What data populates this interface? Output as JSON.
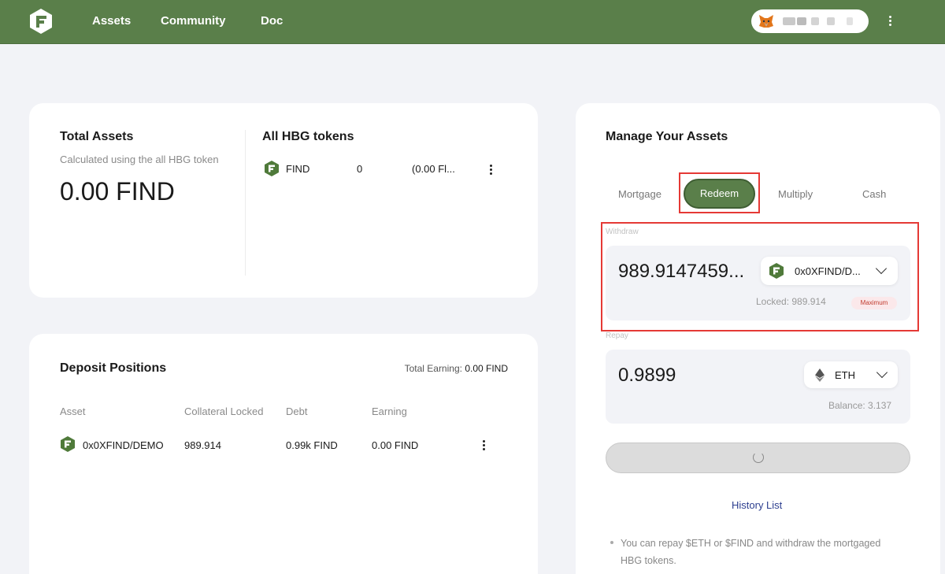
{
  "nav": {
    "items": [
      "Assets",
      "Community",
      "Doc"
    ]
  },
  "total_assets": {
    "title": "Total Assets",
    "subtitle": "Calculated using the all HBG token",
    "value": "0.00 FIND"
  },
  "hbg_tokens": {
    "title": "All HBG tokens",
    "row": {
      "symbol": "FIND",
      "amount": "0",
      "value": "(0.00 Fl..."
    }
  },
  "deposit": {
    "title": "Deposit Positions",
    "total_earning_label": "Total Earning:",
    "total_earning_value": "0.00 FIND",
    "columns": [
      "Asset",
      "Collateral Locked",
      "Debt",
      "Earning"
    ],
    "rows": [
      {
        "asset": "0x0XFIND/DEMO",
        "collateral": "989.914",
        "debt": "0.99k FIND",
        "earning": "0.00 FIND"
      }
    ]
  },
  "manage": {
    "title": "Manage Your Assets",
    "tabs": [
      "Mortgage",
      "Redeem",
      "Multiply",
      "Cash"
    ],
    "active_tab": "Redeem",
    "withdraw": {
      "label": "Withdraw",
      "amount": "989.9147459...",
      "token": "0x0XFIND/D...",
      "locked": "Locked: 989.914",
      "max": "Maximum"
    },
    "repay": {
      "label": "Repay",
      "amount": "0.9899",
      "token": "ETH",
      "balance": "Balance: 3.137"
    },
    "history_link": "History List",
    "note": "You can repay $ETH or $FIND and withdraw the mortgaged HBG tokens."
  },
  "colors": {
    "brand": "#5a7f4a",
    "highlight": "#e53935"
  },
  "icons": [
    "brand-logo-icon",
    "metamask-fox-icon",
    "more-vertical-icon",
    "find-token-icon",
    "ethereum-icon",
    "chevron-down-icon",
    "loading-spinner-icon"
  ]
}
